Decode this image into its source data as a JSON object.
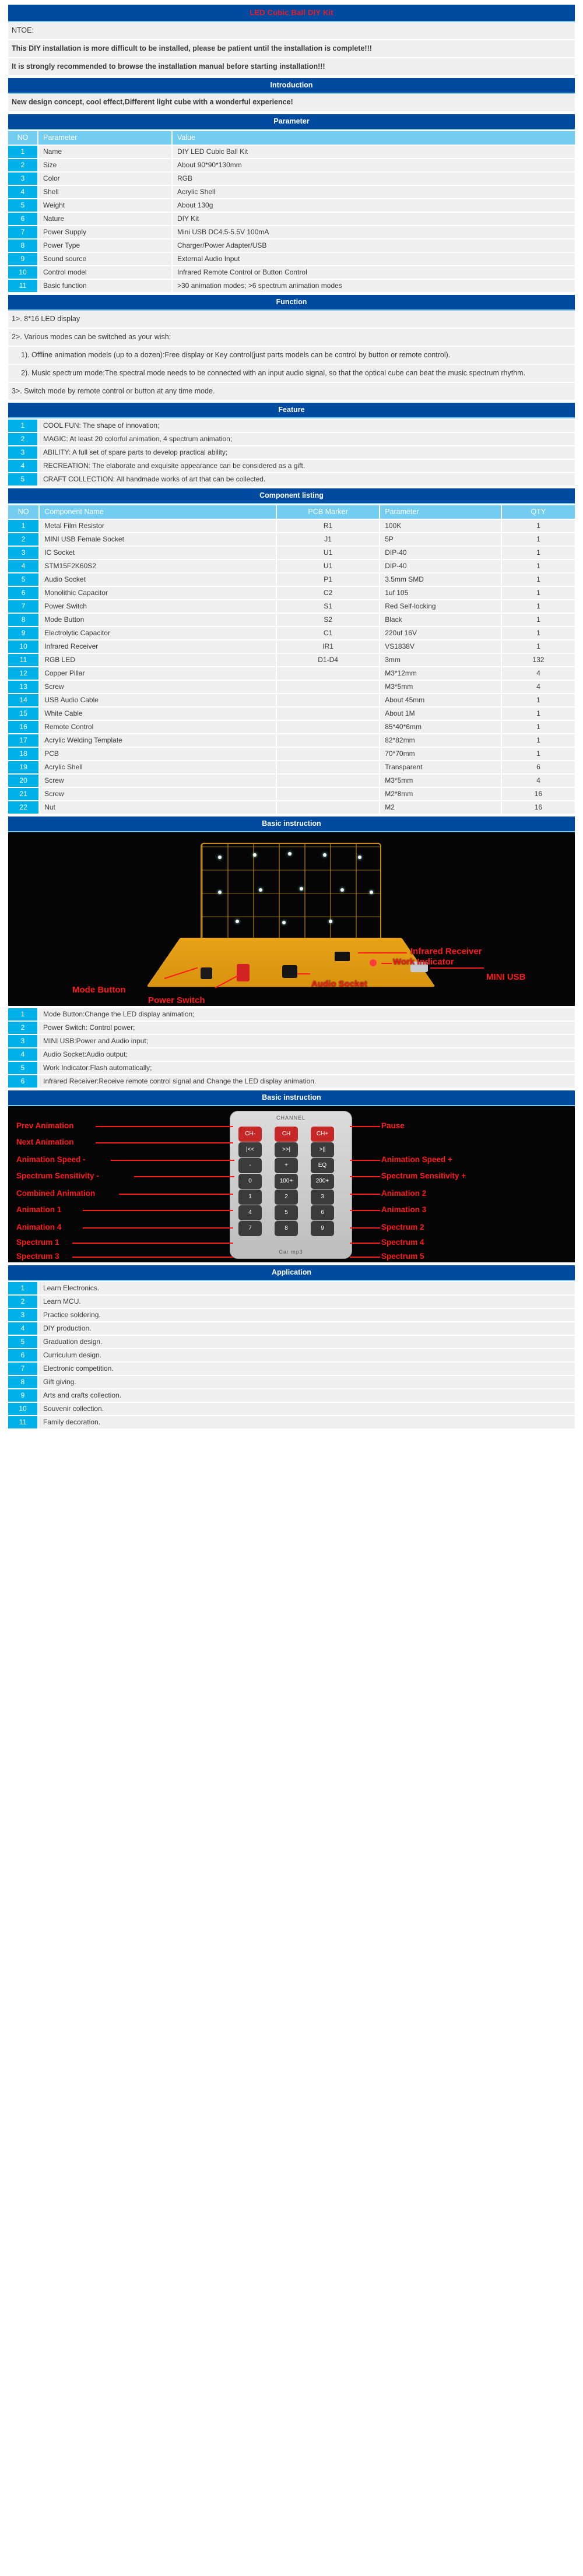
{
  "header": {
    "title": "LED Cubic Ball DIY Kit"
  },
  "note": {
    "label": "NTOE:",
    "lines": [
      "This DIY installation is more difficult to be installed, please be patient until the installation is complete!!!",
      "It is strongly recommended to browse the installation manual before starting installation!!!"
    ]
  },
  "introduction": {
    "title": "Introduction",
    "text": "New design concept, cool effect,Different light cube with a wonderful experience!"
  },
  "parameter": {
    "title": "Parameter",
    "columns": [
      "NO",
      "Parameter",
      "Value"
    ],
    "rows": [
      [
        "1",
        "Name",
        "DIY LED Cubic Ball Kit"
      ],
      [
        "2",
        "Size",
        "About 90*90*130mm"
      ],
      [
        "3",
        "Color",
        "RGB"
      ],
      [
        "4",
        "Shell",
        "Acrylic Shell"
      ],
      [
        "5",
        "Weight",
        "About 130g"
      ],
      [
        "6",
        "Nature",
        "DIY Kit"
      ],
      [
        "7",
        "Power Supply",
        "Mini USB DC4.5-5.5V 100mA"
      ],
      [
        "8",
        "Power Type",
        "Charger/Power Adapter/USB"
      ],
      [
        "9",
        "Sound source",
        "External Audio Input"
      ],
      [
        "10",
        "Control model",
        "Infrared Remote Control or Button Control"
      ],
      [
        "11",
        "Basic function",
        ">30 animation modes; >6 spectrum animation modes"
      ]
    ]
  },
  "function": {
    "title": "Function",
    "lines": [
      {
        "indent": 0,
        "text": "1>. 8*16 LED display"
      },
      {
        "indent": 0,
        "text": "2>. Various modes can be switched as your wish:"
      },
      {
        "indent": 1,
        "text": "1). Offline animation models (up to a dozen):Free display or Key control(just parts models can be control by button or remote control)."
      },
      {
        "indent": 1,
        "text": "2). Music spectrum mode:The spectral mode needs to be connected with an input audio signal, so that the optical cube can beat the music spectrum rhythm."
      },
      {
        "indent": 0,
        "text": "3>. Switch mode by remote control or button at any time mode."
      }
    ]
  },
  "feature": {
    "title": "Feature",
    "rows": [
      [
        "1",
        "COOL FUN: The shape of innovation;"
      ],
      [
        "2",
        "MAGIC: At least 20 colorful animation, 4 spectrum animation;"
      ],
      [
        "3",
        "ABILITY: A full set of spare parts to develop practical ability;"
      ],
      [
        "4",
        "RECREATION: The elaborate and exquisite appearance can be considered as a gift."
      ],
      [
        "5",
        "CRAFT COLLECTION: All handmade works of art that can be collected."
      ]
    ]
  },
  "component_listing": {
    "title": "Component listing",
    "columns": [
      "NO",
      "Component Name",
      "PCB Marker",
      "Parameter",
      "QTY"
    ],
    "rows": [
      [
        "1",
        "Metal Film Resistor",
        "R1",
        "100K",
        "1"
      ],
      [
        "2",
        "MINI USB Female Socket",
        "J1",
        "5P",
        "1"
      ],
      [
        "3",
        "IC Socket",
        "U1",
        "DIP-40",
        "1"
      ],
      [
        "4",
        "STM15F2K60S2",
        "U1",
        "DIP-40",
        "1"
      ],
      [
        "5",
        "Audio Socket",
        "P1",
        "3.5mm SMD",
        "1"
      ],
      [
        "6",
        "Monolithic Capacitor",
        "C2",
        "1uf 105",
        "1"
      ],
      [
        "7",
        "Power Switch",
        "S1",
        "Red Self-locking",
        "1"
      ],
      [
        "8",
        "Mode Button",
        "S2",
        "Black",
        "1"
      ],
      [
        "9",
        "Electrolytic Capacitor",
        "C1",
        "220uf 16V",
        "1"
      ],
      [
        "10",
        "Infrared Receiver",
        "IR1",
        "VS1838V",
        "1"
      ],
      [
        "11",
        "RGB LED",
        "D1-D4",
        "3mm",
        "132"
      ],
      [
        "12",
        "Copper Pillar",
        "",
        "M3*12mm",
        "4"
      ],
      [
        "13",
        "Screw",
        "",
        "M3*5mm",
        "4"
      ],
      [
        "14",
        "USB Audio Cable",
        "",
        "About 45mm",
        "1"
      ],
      [
        "15",
        "White Cable",
        "",
        "About 1M",
        "1"
      ],
      [
        "16",
        "Remote Control",
        "",
        "85*40*6mm",
        "1"
      ],
      [
        "17",
        "Acrylic Welding Template",
        "",
        "82*82mm",
        "1"
      ],
      [
        "18",
        "PCB",
        "",
        "70*70mm",
        "1"
      ],
      [
        "19",
        "Acrylic Shell",
        "",
        "Transparent",
        "6"
      ],
      [
        "20",
        "Screw",
        "",
        "M3*5mm",
        "4"
      ],
      [
        "21",
        "Screw",
        "",
        "M2*8mm",
        "16"
      ],
      [
        "22",
        "Nut",
        "",
        "M2",
        "16"
      ]
    ]
  },
  "basic_instruction_1": {
    "title": "Basic instruction",
    "photo_annotations": [
      "Infrared Receiver",
      "Work Indicator",
      "MINI USB",
      "Audio Socket",
      "Mode Button",
      "Power Switch"
    ],
    "rows": [
      [
        "1",
        "Mode Button:Change the LED display animation;"
      ],
      [
        "2",
        "Power Switch: Control power;"
      ],
      [
        "3",
        "MINI USB:Power and Audio input;"
      ],
      [
        "4",
        "Audio Socket:Audio output;"
      ],
      [
        "5",
        "Work Indicator:Flash automatically;"
      ],
      [
        "6",
        "Infrared Receiver:Receive remote control signal and Change the LED display animation."
      ]
    ]
  },
  "basic_instruction_2": {
    "title": "Basic instruction",
    "remote": {
      "brand": "CHANNEL",
      "left_labels": [
        "Prev Animation",
        "Next Animation",
        "Animation Speed -",
        "Spectrum Sensitivity -",
        "Combined Animation",
        "Animation 1",
        "Animation 4",
        "Spectrum 1",
        "Spectrum 3"
      ],
      "right_labels": [
        "Pause",
        "Animation Speed +",
        "Spectrum Sensitivity +",
        "Animation 2",
        "Animation 3",
        "Spectrum 2",
        "Spectrum 4",
        "Spectrum 5"
      ],
      "keys": [
        "CH-",
        "CH",
        "CH+",
        "|<<",
        ">>|",
        ">||",
        "-",
        "+",
        "EQ",
        "0",
        "100+",
        "200+",
        "1",
        "2",
        "3",
        "4",
        "5",
        "6",
        "7",
        "8",
        "9"
      ],
      "footer": "Car mp3"
    }
  },
  "application": {
    "title": "Application",
    "rows": [
      [
        "1",
        "Learn Electronics."
      ],
      [
        "2",
        "Learn MCU."
      ],
      [
        "3",
        "Practice soldering."
      ],
      [
        "4",
        "DIY production."
      ],
      [
        "5",
        "Graduation design."
      ],
      [
        "6",
        "Curriculum design."
      ],
      [
        "7",
        "Electronic competition."
      ],
      [
        "8",
        "Gift giving."
      ],
      [
        "9",
        "Arts and crafts collection."
      ],
      [
        "10",
        "Souvenir collection."
      ],
      [
        "11",
        "Family decoration."
      ]
    ]
  },
  "colors": {
    "header_blue": "#004a9f",
    "title_red": "#ec1c24",
    "table_header": "#72cdf0",
    "row_no": "#00b0e8",
    "row_bg": "#efefef",
    "annotation_red": "#ff1a1a"
  }
}
